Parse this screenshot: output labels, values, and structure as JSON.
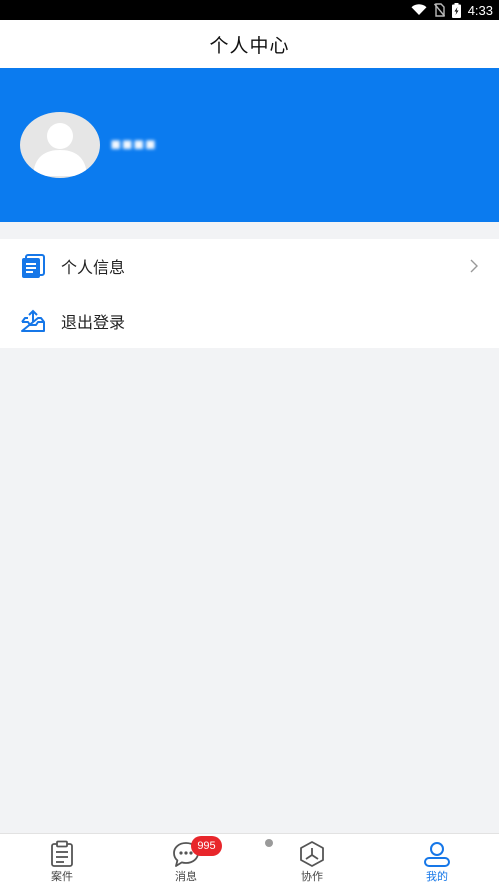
{
  "status_bar": {
    "time": "4:33",
    "icons": [
      "wifi-icon",
      "no-sim-icon",
      "battery-charging-icon"
    ]
  },
  "header": {
    "title": "个人中心"
  },
  "profile": {
    "username": "▪▪▪▪"
  },
  "menu": [
    {
      "label": "个人信息",
      "icon": "document-list-icon",
      "has_arrow": true
    },
    {
      "label": "退出登录",
      "icon": "logout-tray-icon",
      "has_arrow": false
    }
  ],
  "tabs": [
    {
      "label": "案件",
      "icon": "clipboard-icon",
      "active": false
    },
    {
      "label": "消息",
      "icon": "chat-bubble-icon",
      "active": false,
      "badge": "995"
    },
    {
      "label": "协作",
      "icon": "hexagon-collab-icon",
      "active": false
    },
    {
      "label": "我的",
      "icon": "person-icon",
      "active": true
    }
  ],
  "colors": {
    "accent": "#0b7bef",
    "badge": "#e8262b",
    "background": "#f2f3f5",
    "active_tab": "#1677e8"
  }
}
